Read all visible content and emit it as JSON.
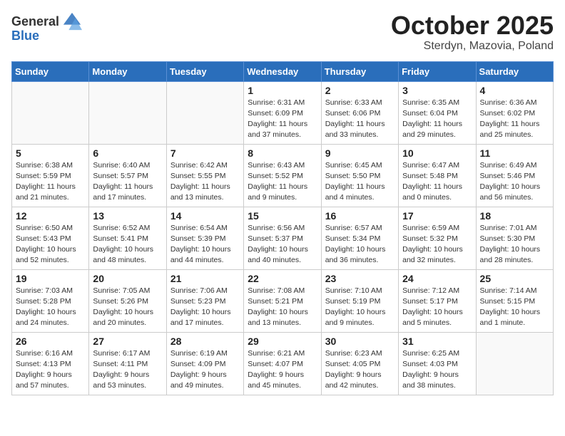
{
  "header": {
    "logo_general": "General",
    "logo_blue": "Blue",
    "month_title": "October 2025",
    "subtitle": "Sterdyn, Mazovia, Poland"
  },
  "days_of_week": [
    "Sunday",
    "Monday",
    "Tuesday",
    "Wednesday",
    "Thursday",
    "Friday",
    "Saturday"
  ],
  "weeks": [
    [
      {
        "day": "",
        "info": ""
      },
      {
        "day": "",
        "info": ""
      },
      {
        "day": "",
        "info": ""
      },
      {
        "day": "1",
        "info": "Sunrise: 6:31 AM\nSunset: 6:09 PM\nDaylight: 11 hours\nand 37 minutes."
      },
      {
        "day": "2",
        "info": "Sunrise: 6:33 AM\nSunset: 6:06 PM\nDaylight: 11 hours\nand 33 minutes."
      },
      {
        "day": "3",
        "info": "Sunrise: 6:35 AM\nSunset: 6:04 PM\nDaylight: 11 hours\nand 29 minutes."
      },
      {
        "day": "4",
        "info": "Sunrise: 6:36 AM\nSunset: 6:02 PM\nDaylight: 11 hours\nand 25 minutes."
      }
    ],
    [
      {
        "day": "5",
        "info": "Sunrise: 6:38 AM\nSunset: 5:59 PM\nDaylight: 11 hours\nand 21 minutes."
      },
      {
        "day": "6",
        "info": "Sunrise: 6:40 AM\nSunset: 5:57 PM\nDaylight: 11 hours\nand 17 minutes."
      },
      {
        "day": "7",
        "info": "Sunrise: 6:42 AM\nSunset: 5:55 PM\nDaylight: 11 hours\nand 13 minutes."
      },
      {
        "day": "8",
        "info": "Sunrise: 6:43 AM\nSunset: 5:52 PM\nDaylight: 11 hours\nand 9 minutes."
      },
      {
        "day": "9",
        "info": "Sunrise: 6:45 AM\nSunset: 5:50 PM\nDaylight: 11 hours\nand 4 minutes."
      },
      {
        "day": "10",
        "info": "Sunrise: 6:47 AM\nSunset: 5:48 PM\nDaylight: 11 hours\nand 0 minutes."
      },
      {
        "day": "11",
        "info": "Sunrise: 6:49 AM\nSunset: 5:46 PM\nDaylight: 10 hours\nand 56 minutes."
      }
    ],
    [
      {
        "day": "12",
        "info": "Sunrise: 6:50 AM\nSunset: 5:43 PM\nDaylight: 10 hours\nand 52 minutes."
      },
      {
        "day": "13",
        "info": "Sunrise: 6:52 AM\nSunset: 5:41 PM\nDaylight: 10 hours\nand 48 minutes."
      },
      {
        "day": "14",
        "info": "Sunrise: 6:54 AM\nSunset: 5:39 PM\nDaylight: 10 hours\nand 44 minutes."
      },
      {
        "day": "15",
        "info": "Sunrise: 6:56 AM\nSunset: 5:37 PM\nDaylight: 10 hours\nand 40 minutes."
      },
      {
        "day": "16",
        "info": "Sunrise: 6:57 AM\nSunset: 5:34 PM\nDaylight: 10 hours\nand 36 minutes."
      },
      {
        "day": "17",
        "info": "Sunrise: 6:59 AM\nSunset: 5:32 PM\nDaylight: 10 hours\nand 32 minutes."
      },
      {
        "day": "18",
        "info": "Sunrise: 7:01 AM\nSunset: 5:30 PM\nDaylight: 10 hours\nand 28 minutes."
      }
    ],
    [
      {
        "day": "19",
        "info": "Sunrise: 7:03 AM\nSunset: 5:28 PM\nDaylight: 10 hours\nand 24 minutes."
      },
      {
        "day": "20",
        "info": "Sunrise: 7:05 AM\nSunset: 5:26 PM\nDaylight: 10 hours\nand 20 minutes."
      },
      {
        "day": "21",
        "info": "Sunrise: 7:06 AM\nSunset: 5:23 PM\nDaylight: 10 hours\nand 17 minutes."
      },
      {
        "day": "22",
        "info": "Sunrise: 7:08 AM\nSunset: 5:21 PM\nDaylight: 10 hours\nand 13 minutes."
      },
      {
        "day": "23",
        "info": "Sunrise: 7:10 AM\nSunset: 5:19 PM\nDaylight: 10 hours\nand 9 minutes."
      },
      {
        "day": "24",
        "info": "Sunrise: 7:12 AM\nSunset: 5:17 PM\nDaylight: 10 hours\nand 5 minutes."
      },
      {
        "day": "25",
        "info": "Sunrise: 7:14 AM\nSunset: 5:15 PM\nDaylight: 10 hours\nand 1 minute."
      }
    ],
    [
      {
        "day": "26",
        "info": "Sunrise: 6:16 AM\nSunset: 4:13 PM\nDaylight: 9 hours\nand 57 minutes."
      },
      {
        "day": "27",
        "info": "Sunrise: 6:17 AM\nSunset: 4:11 PM\nDaylight: 9 hours\nand 53 minutes."
      },
      {
        "day": "28",
        "info": "Sunrise: 6:19 AM\nSunset: 4:09 PM\nDaylight: 9 hours\nand 49 minutes."
      },
      {
        "day": "29",
        "info": "Sunrise: 6:21 AM\nSunset: 4:07 PM\nDaylight: 9 hours\nand 45 minutes."
      },
      {
        "day": "30",
        "info": "Sunrise: 6:23 AM\nSunset: 4:05 PM\nDaylight: 9 hours\nand 42 minutes."
      },
      {
        "day": "31",
        "info": "Sunrise: 6:25 AM\nSunset: 4:03 PM\nDaylight: 9 hours\nand 38 minutes."
      },
      {
        "day": "",
        "info": ""
      }
    ]
  ]
}
